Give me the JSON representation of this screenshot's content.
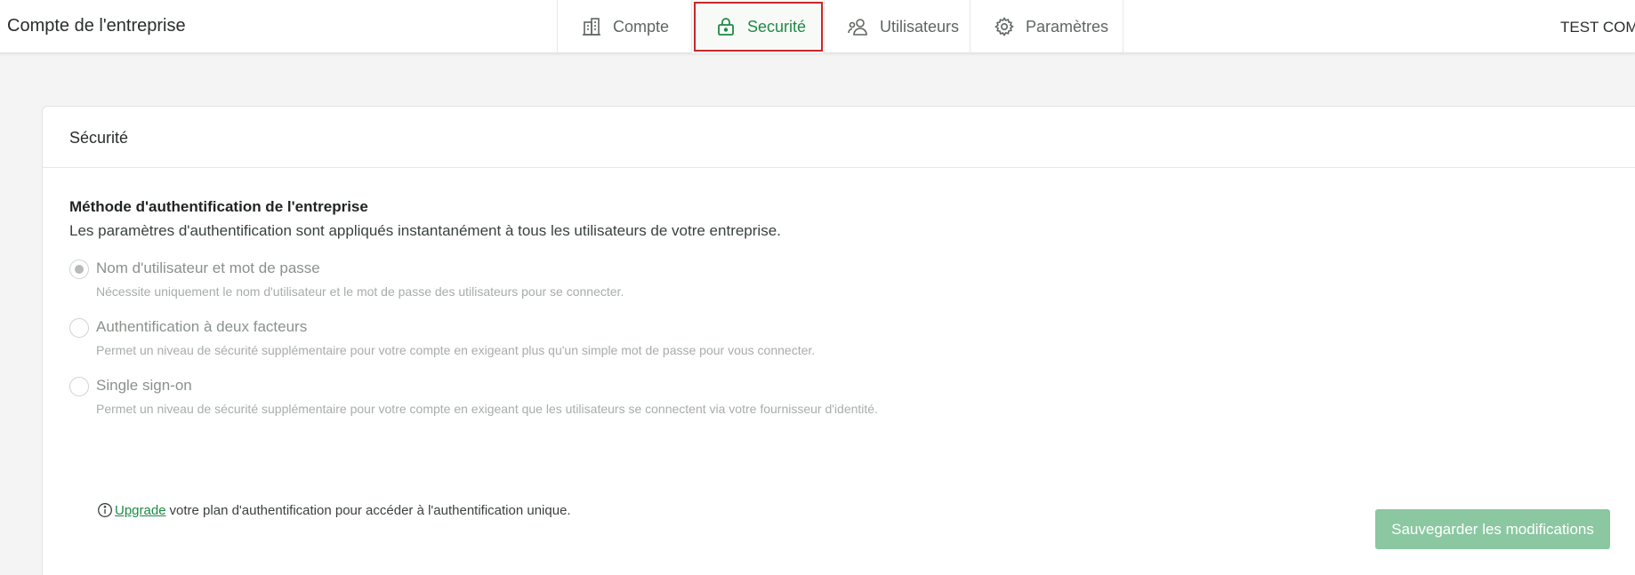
{
  "header": {
    "title": "Compte de l'entreprise",
    "user": "TEST COMI",
    "tabs": [
      {
        "label": "Compte",
        "icon": "building-icon"
      },
      {
        "label": "Securité",
        "icon": "lock-icon"
      },
      {
        "label": "Utilisateurs",
        "icon": "users-icon"
      },
      {
        "label": "Paramètres",
        "icon": "gear-icon"
      }
    ],
    "active_tab_color": "#1e8a45",
    "highlight_color": "#c62828"
  },
  "card": {
    "title": "Sécurité",
    "section_title": "Méthode d'authentification de l'entreprise",
    "section_desc": "Les paramètres d'authentification sont appliqués instantanément à tous les utilisateurs de votre entreprise.",
    "options": [
      {
        "label": "Nom d'utilisateur et mot de passe",
        "desc": "Nécessite uniquement le nom d'utilisateur et le mot de passe des utilisateurs pour se connecter.",
        "checked": true
      },
      {
        "label": "Authentification à deux facteurs",
        "desc": "Permet un niveau de sécurité supplémentaire pour votre compte en exigeant plus qu'un simple mot de passe pour vous connecter.",
        "checked": false
      },
      {
        "label": "Single sign-on",
        "desc": "Permet un niveau de sécurité supplémentaire pour votre compte en exigeant que les utilisateurs se connectent via votre fournisseur d'identité.",
        "checked": false
      }
    ],
    "info": {
      "link": "Upgrade",
      "text": "votre plan d'authentification pour accéder à l'authentification unique.",
      "icon": "info-icon"
    },
    "save_label": "Sauvegarder les modifications",
    "save_color": "#8bc7a1"
  }
}
